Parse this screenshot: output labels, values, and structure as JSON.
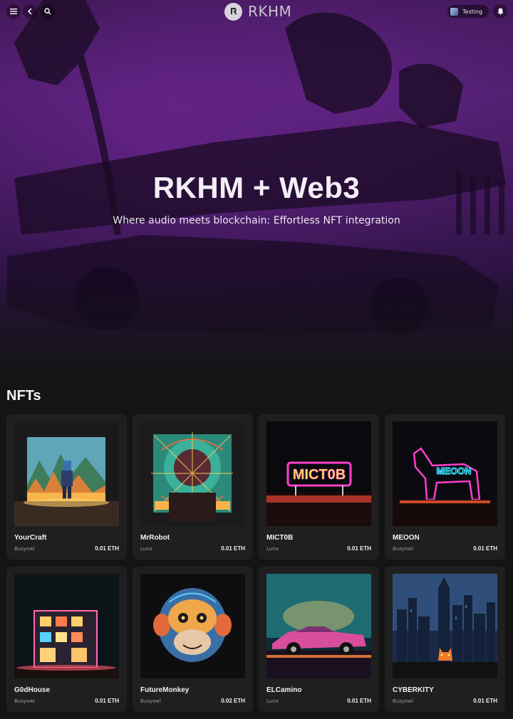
{
  "header": {
    "menu_icon": "hamburger-menu-icon",
    "back_icon": "chevron-left-icon",
    "search_icon": "search-icon",
    "logo_text": "RKHM",
    "user_name": "Testing",
    "bell_icon": "bell-icon"
  },
  "hero": {
    "title": "RKHM + Web3",
    "subtitle": "Where audio meets blockchain: Effortless NFT integration"
  },
  "nfts": {
    "section_title": "NFTs",
    "items": [
      {
        "name": "YourCraft",
        "creator": "Busyowl",
        "price": "0.01 ETH"
      },
      {
        "name": "MrRobot",
        "creator": "Luna",
        "price": "0.01 ETH"
      },
      {
        "name": "MICT0B",
        "creator": "Luna",
        "price": "0.01 ETH"
      },
      {
        "name": "MEOON",
        "creator": "Busyowl",
        "price": "0.01 ETH"
      },
      {
        "name": "G0dHouse",
        "creator": "Busyowl",
        "price": "0.01 ETH"
      },
      {
        "name": "FutureMonkey",
        "creator": "Busyowl",
        "price": "0.02 ETH"
      },
      {
        "name": "ELCamino",
        "creator": "Luna",
        "price": "0.01 ETH"
      },
      {
        "name": "CYBERKITY",
        "creator": "Busyowl",
        "price": "0.01 ETH"
      }
    ]
  },
  "art_text": {
    "sign_1": "MICT0B",
    "sign_2": "MEOON"
  },
  "colors": {
    "hero_purple": "#4a1d66",
    "page_bg": "#141414",
    "card_bg": "#1f1f1f",
    "neon_pink": "#ff3fc8",
    "neon_cyan": "#38e0ff"
  }
}
